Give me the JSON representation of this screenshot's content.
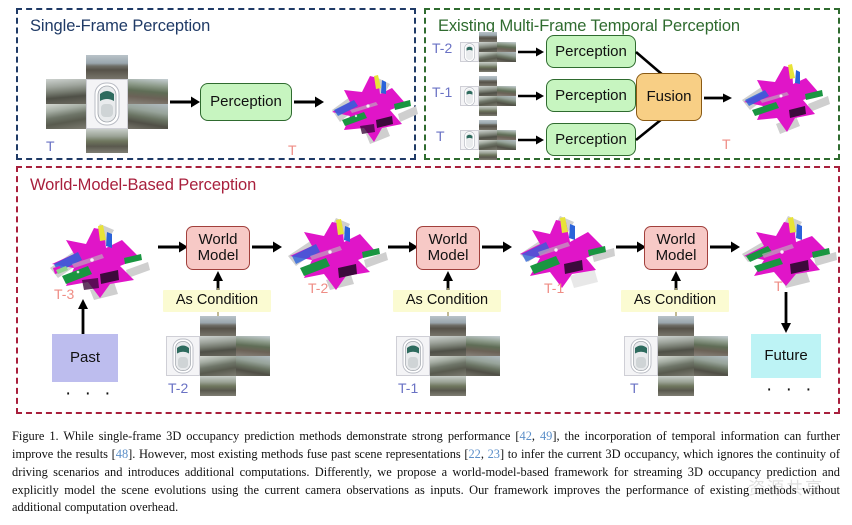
{
  "figure": {
    "panels": {
      "single": {
        "title": "Single-Frame Perception",
        "border_color": "#1f3a66",
        "title_color": "#1f3a66",
        "input_label": "T",
        "process_label": "Perception",
        "output_label": "T"
      },
      "multi": {
        "title": "Existing Multi-Frame Temporal Perception",
        "border_color": "#2f6b2f",
        "title_color": "#2f6b2f",
        "input_labels": [
          "T-2",
          "T-1",
          "T"
        ],
        "process_label": "Perception",
        "fusion_label": "Fusion",
        "output_label": "T"
      },
      "world": {
        "title": "World-Model-Based Perception",
        "border_color": "#a81f3c",
        "title_color": "#a81f3c",
        "past_label": "Past",
        "future_label": "Future",
        "world_model_label_line1": "World",
        "world_model_label_line2": "Model",
        "condition_label": "As Condition",
        "ellipsis": "· · ·",
        "occupancy_labels": [
          "T-3",
          "T-2",
          "T-1",
          "T"
        ],
        "camera_labels": [
          "T-2",
          "T-1",
          "T"
        ]
      }
    },
    "colors": {
      "perception_fill": "#c7f5c0",
      "perception_stroke": "#2f6b2f",
      "fusion_fill": "#f8cf85",
      "fusion_stroke": "#8a5a14",
      "world_model_fill": "#f7c9c6",
      "world_model_stroke": "#a1403c",
      "condition_fill": "#fbfbd2",
      "past_fill": "#bdbdee",
      "future_fill": "#bdf3f5",
      "timestep_blue": "#6a72c4",
      "timestep_salmon": "#ef8d85",
      "occupancy_magenta": "#e015c8",
      "occupancy_green": "#1a9641",
      "occupancy_blue": "#2b63d9",
      "occupancy_yellow": "#e8e337",
      "occupancy_gray": "#cfcfcf",
      "occupancy_darkpurple": "#3c0a3c",
      "reference_link": "#5b8fc9"
    }
  },
  "caption": {
    "label": "Figure 1.",
    "seg1": "  While single-frame 3D occupancy prediction methods demonstrate strong performance [",
    "ref1": "42",
    "seg1b": ", ",
    "ref2": "49",
    "seg2": "], the incorporation of temporal information can further improve the results [",
    "ref3": "48",
    "seg3": "]. However, most existing methods fuse past scene representations [",
    "ref4": "22",
    "seg3b": ", ",
    "ref5": "23",
    "seg4": "] to infer the current 3D occupancy, which ignores the continuity of driving scenarios and introduces additional computations. Differently, we propose a world-model-based framework for streaming 3D occupancy prediction and explicitly model the scene evolutions using the current camera observations as inputs. Our framework improves the performance of existing methods without additional computation overhead."
  },
  "watermark": {
    "text": "资源共享"
  }
}
